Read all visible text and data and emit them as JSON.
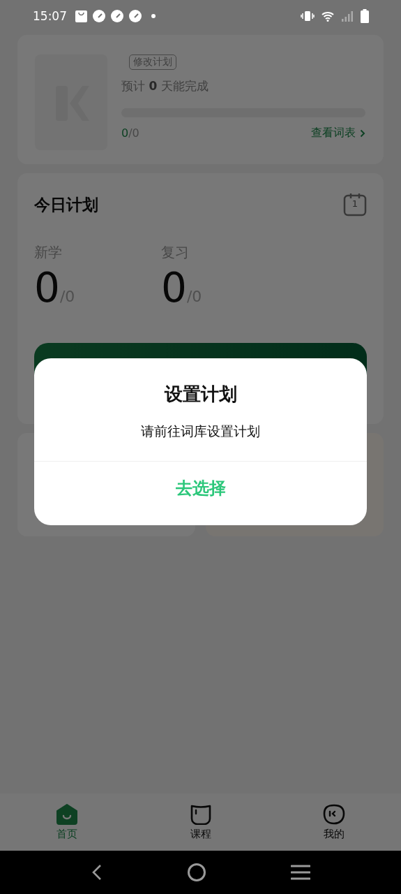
{
  "status_bar": {
    "time": "15:07"
  },
  "book_card": {
    "tag": "修改计划",
    "estimate": "预计 **0** 天能完成",
    "progress": {
      "level": 0
    },
    "learned": "0",
    "total": "/0",
    "link": "查看词表"
  },
  "today_plan": {
    "title": "今日计划",
    "calendar_day": "1",
    "stats": [
      {
        "label": "新学",
        "value": "0",
        "total": "/0"
      },
      {
        "label": "复习",
        "value": "0",
        "total": "/0"
      }
    ]
  },
  "dialog": {
    "title": "设置计划",
    "message": "请前往词库设置计划",
    "action": "去选择"
  },
  "tab_bar": {
    "items": [
      {
        "label": "首页",
        "selected": true
      },
      {
        "label": "课程",
        "selected": false
      },
      {
        "label": "我的",
        "selected": false
      }
    ]
  }
}
